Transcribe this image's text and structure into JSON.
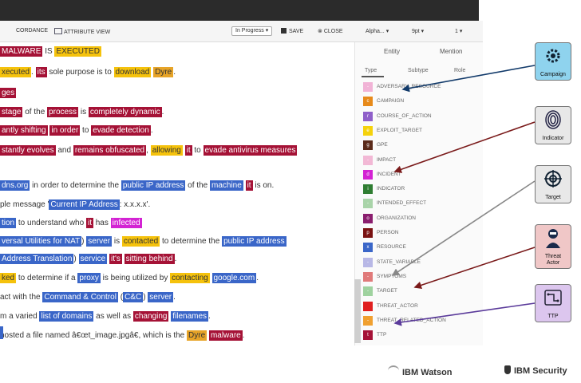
{
  "toolbar": {
    "tab_coreference": "CORDANCE",
    "tab_attribute_view": "ATTRIBUTE VIEW",
    "status_select": "In Progress",
    "save_label": "SAVE",
    "close_label": "CLOSE",
    "sort_select": "Alpha...",
    "font_size_select": "9pt",
    "zoom_select": "1"
  },
  "panel": {
    "tabs": [
      "Entity",
      "Mention"
    ],
    "subtabs": [
      "Type",
      "Subtype",
      "Role"
    ],
    "types": [
      {
        "letter": "-",
        "name": "ADVERSARY_RESOURCE",
        "color": "#f1b3d6"
      },
      {
        "letter": "c",
        "name": "CAMPAIGN",
        "color": "#e78a1a"
      },
      {
        "letter": "r",
        "name": "COURSE_OF_ACTION",
        "color": "#8f5fc9"
      },
      {
        "letter": "e",
        "name": "EXPLOIT_TARGET",
        "color": "#f5d20c"
      },
      {
        "letter": "g",
        "name": "GPE",
        "color": "#5a2a1a"
      },
      {
        "letter": "-",
        "name": "IMPACT",
        "color": "#f2b8d5"
      },
      {
        "letter": "d",
        "name": "INCIDENT",
        "color": "#d322d3"
      },
      {
        "letter": "i",
        "name": "INDICATOR",
        "color": "#2f7d32"
      },
      {
        "letter": "-",
        "name": "INTENDED_EFFECT",
        "color": "#a9d4a9"
      },
      {
        "letter": "o",
        "name": "ORGANIZATION",
        "color": "#8a1e6e"
      },
      {
        "letter": "p",
        "name": "PERSON",
        "color": "#7a1212"
      },
      {
        "letter": "x",
        "name": "RESOURCE",
        "color": "#3a66c8"
      },
      {
        "letter": "-",
        "name": "STATE_VARIABLE",
        "color": "#b8b8e6"
      },
      {
        "letter": "-",
        "name": "SYMPTOMS",
        "color": "#e07a7a"
      },
      {
        "letter": "-",
        "name": "TARGET",
        "color": "#9fd29f"
      },
      {
        "letter": "",
        "name": "THREAT_ACTOR",
        "color": "#e01f1f"
      },
      {
        "letter": "-",
        "name": "THREAT_RELATED_ACTION",
        "color": "#f0a030"
      },
      {
        "letter": "t",
        "name": "TTP",
        "color": "#a51236"
      }
    ]
  },
  "badges": {
    "campaign": "Campaign",
    "indicator": "Indicator",
    "target": "Target",
    "threat_actor_1": "Threat",
    "threat_actor_2": "Actor",
    "ttp": "TTP"
  },
  "logos": {
    "watson": "IBM Watson",
    "security": "IBM Security"
  },
  "text_lines": [
    [
      [
        "MALWARE",
        "red"
      ],
      [
        " IS ",
        ""
      ],
      [
        "EXECUTED",
        "yel"
      ]
    ],
    [
      [
        "xecuted",
        "yel"
      ],
      [
        ". ",
        ""
      ],
      [
        "its",
        "red"
      ],
      [
        " sole purpose is to ",
        ""
      ],
      [
        "download",
        "yel"
      ],
      [
        " ",
        ""
      ],
      [
        "Dyre",
        "org"
      ],
      [
        ".",
        ""
      ]
    ],
    [
      [
        "ges",
        "red"
      ]
    ],
    [
      [
        " stage",
        "red"
      ],
      [
        " of the ",
        ""
      ],
      [
        "process",
        "red"
      ],
      [
        " is ",
        ""
      ],
      [
        "completely dynamic",
        "red"
      ],
      [
        ".",
        ""
      ]
    ],
    [
      [
        "antly shifting",
        "red"
      ],
      [
        " ",
        ""
      ],
      [
        "in order",
        "red"
      ],
      [
        " to ",
        ""
      ],
      [
        "evade detection",
        "red"
      ],
      [
        ".",
        ""
      ]
    ],
    [
      [
        "stantly evolves",
        "red"
      ],
      [
        " and ",
        ""
      ],
      [
        "remains obfuscated",
        "red"
      ],
      [
        ", ",
        ""
      ],
      [
        "allowing",
        "yel"
      ],
      [
        " ",
        ""
      ],
      [
        "it",
        "red"
      ],
      [
        " to ",
        ""
      ],
      [
        "evade antivirus measures",
        "red"
      ]
    ],
    [],
    [
      [
        "dns.org",
        "blu"
      ],
      [
        " in order to determine the ",
        ""
      ],
      [
        "public IP address",
        "blu"
      ],
      [
        " of the ",
        ""
      ],
      [
        "machine",
        "blu"
      ],
      [
        " ",
        ""
      ],
      [
        "it",
        "red"
      ],
      [
        " is on.",
        ""
      ]
    ],
    [
      [
        "ple message '",
        ""
      ],
      [
        "Current IP Address",
        "blu"
      ],
      [
        ": x.x.x.x'.",
        ""
      ]
    ],
    [
      [
        "tion",
        "blu"
      ],
      [
        " to understand who ",
        ""
      ],
      [
        "it",
        "red"
      ],
      [
        " has ",
        ""
      ],
      [
        "infected",
        "mag"
      ]
    ],
    [
      [
        "versal Utilities for NAT",
        "blu"
      ],
      [
        ") ",
        ""
      ],
      [
        "server",
        "blu"
      ],
      [
        " is ",
        ""
      ],
      [
        "contacted",
        "yel"
      ],
      [
        " to determine the ",
        ""
      ],
      [
        "public IP address",
        "blu"
      ]
    ],
    [
      [
        " Address Translation",
        "blu"
      ],
      [
        ") ",
        ""
      ],
      [
        "service",
        "blu"
      ],
      [
        " ",
        ""
      ],
      [
        "it's",
        "red"
      ],
      [
        " ",
        ""
      ],
      [
        "sitting behind",
        "red"
      ],
      [
        ".",
        ""
      ]
    ],
    [
      [
        "ked",
        "yel"
      ],
      [
        " to determine if a ",
        ""
      ],
      [
        "proxy",
        "blu"
      ],
      [
        " is being utilized by ",
        ""
      ],
      [
        "contacting",
        "yel"
      ],
      [
        " ",
        ""
      ],
      [
        "google.com",
        "blu"
      ],
      [
        ".",
        ""
      ]
    ],
    [
      [
        "act with the ",
        ""
      ],
      [
        "Command & Control",
        "blu"
      ],
      [
        " (",
        ""
      ],
      [
        "C&C",
        "blu"
      ],
      [
        ") ",
        ""
      ],
      [
        "server",
        "blu"
      ],
      [
        ".",
        ""
      ]
    ],
    [
      [
        "m a varied ",
        ""
      ],
      [
        "list of domains",
        "blu"
      ],
      [
        " as well as ",
        ""
      ],
      [
        "changing",
        "red"
      ],
      [
        " ",
        ""
      ],
      [
        "filenames",
        "blu"
      ],
      [
        ".",
        ""
      ]
    ],
    [
      [
        " hosted a file named â€œt_image.jpgâ€, which is the ",
        ""
      ],
      [
        "Dyre",
        "org"
      ],
      [
        " ",
        ""
      ],
      [
        "malware",
        "red"
      ],
      [
        ".",
        ""
      ]
    ]
  ]
}
